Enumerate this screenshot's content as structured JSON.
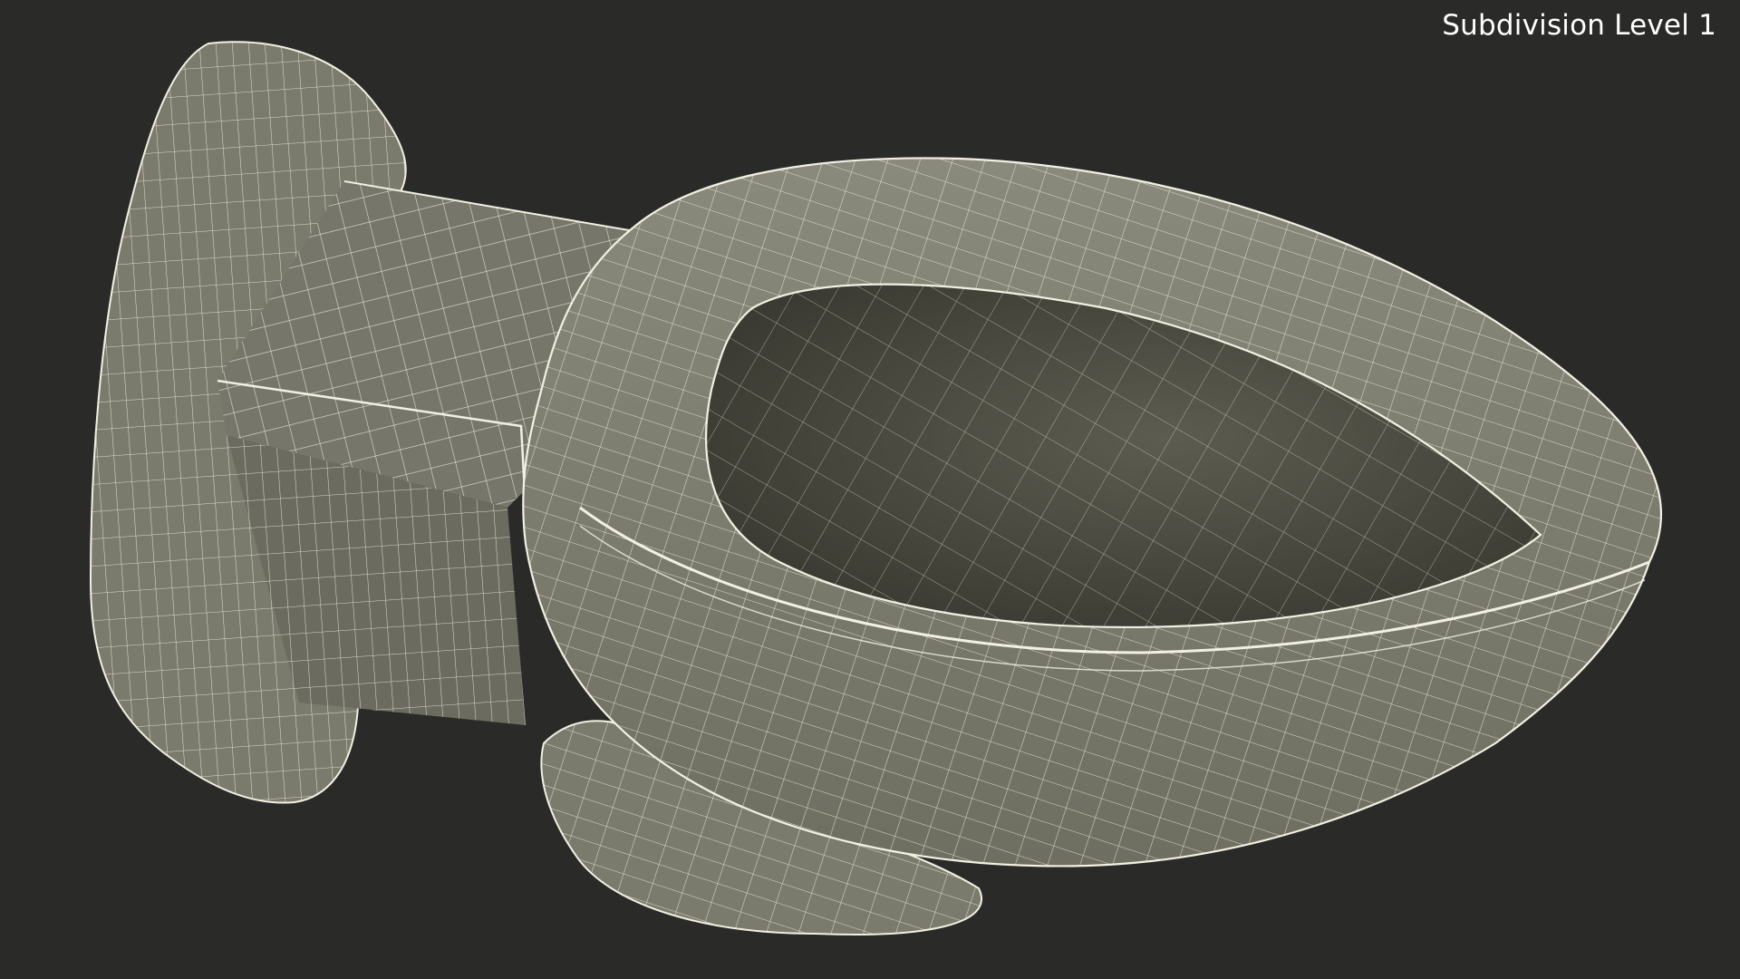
{
  "viewport": {
    "overlay_label": "Subdivision Level 1",
    "background_color": "#2a2a29",
    "mesh_fill_color": "#7d7d6f",
    "mesh_shadow_color": "#45453b",
    "wire_color": "#f2f0e2"
  },
  "subject": {
    "name": "wall-hung toilet wireframe render"
  }
}
